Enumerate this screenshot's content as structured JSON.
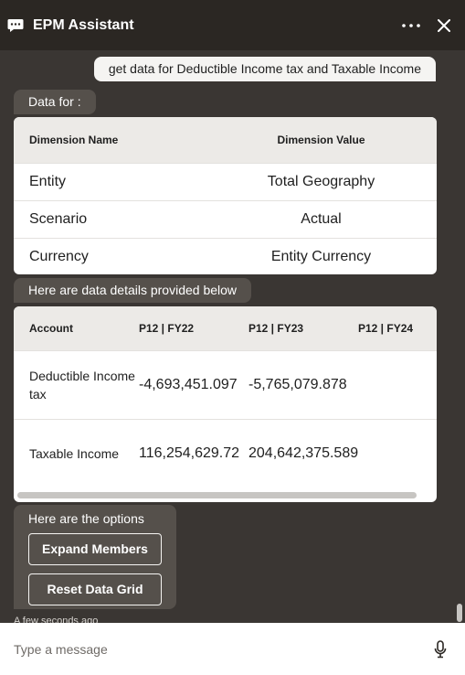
{
  "header": {
    "title": "EPM Assistant"
  },
  "conversation": {
    "user_message": "get data for Deductible Income tax  and Taxable Income",
    "data_for_label": "Data for :",
    "dimension_table": {
      "headers": [
        "Dimension Name",
        "Dimension Value"
      ],
      "rows": [
        [
          "Entity",
          "Total Geography"
        ],
        [
          "Scenario",
          "Actual"
        ],
        [
          "Currency",
          "Entity Currency"
        ]
      ]
    },
    "details_label": "Here are data details provided below",
    "data_table": {
      "headers": [
        "Account",
        "P12 | FY22",
        "P12 | FY23",
        "P12 | FY24"
      ],
      "rows": [
        [
          "Deductible Income tax",
          "-4,693,451.097",
          "-5,765,079.878",
          ""
        ],
        [
          "Taxable Income",
          "116,254,629.72",
          "204,642,375.589",
          ""
        ]
      ]
    },
    "options": {
      "title": "Here are the options",
      "buttons": [
        "Expand Members",
        "Reset Data Grid"
      ]
    },
    "timestamp": "A few seconds ago"
  },
  "composer": {
    "placeholder": "Type a message"
  },
  "icons": {
    "chat": "chat-bubble-icon",
    "more": "more-horizontal-icon",
    "close": "close-icon",
    "mic": "microphone-icon"
  }
}
